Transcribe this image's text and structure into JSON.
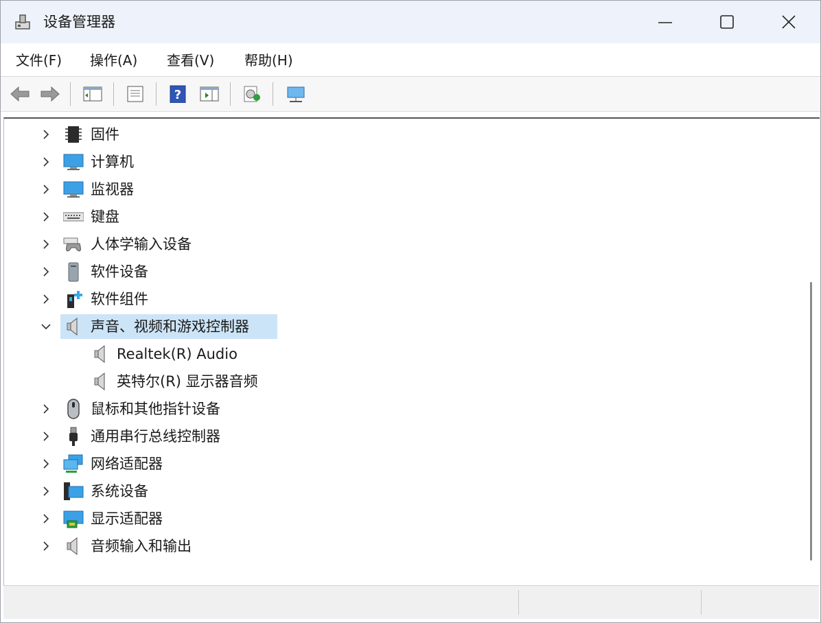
{
  "window": {
    "title": "设备管理器",
    "controls": {
      "minimize": "minimize",
      "maximize": "maximize",
      "close": "close"
    }
  },
  "menu": [
    {
      "label": "文件(F)"
    },
    {
      "label": "操作(A)"
    },
    {
      "label": "查看(V)"
    },
    {
      "label": "帮助(H)"
    }
  ],
  "toolbar": [
    {
      "icon": "back-arrow-icon"
    },
    {
      "icon": "forward-arrow-icon"
    },
    {
      "icon": "show-hide-console-tree-icon"
    },
    {
      "icon": "properties-icon"
    },
    {
      "icon": "help-icon"
    },
    {
      "icon": "action-pane-icon"
    },
    {
      "icon": "scan-hardware-changes-icon"
    },
    {
      "icon": "monitor-device-icon"
    }
  ],
  "tree": {
    "items": [
      {
        "label": "固件",
        "icon": "firmware-chip-icon",
        "expanded": false
      },
      {
        "label": "计算机",
        "icon": "computer-icon",
        "expanded": false
      },
      {
        "label": "监视器",
        "icon": "monitor-icon",
        "expanded": false
      },
      {
        "label": "键盘",
        "icon": "keyboard-icon",
        "expanded": false
      },
      {
        "label": "人体学输入设备",
        "icon": "hid-gamepad-icon",
        "expanded": false
      },
      {
        "label": "软件设备",
        "icon": "software-device-icon",
        "expanded": false
      },
      {
        "label": "软件组件",
        "icon": "software-component-icon",
        "expanded": false
      },
      {
        "label": "声音、视频和游戏控制器",
        "icon": "speaker-icon",
        "expanded": true,
        "selected": true,
        "children": [
          {
            "label": "Realtek(R) Audio",
            "icon": "speaker-icon"
          },
          {
            "label": "英特尔(R) 显示器音频",
            "icon": "speaker-icon"
          }
        ]
      },
      {
        "label": "鼠标和其他指针设备",
        "icon": "mouse-icon",
        "expanded": false
      },
      {
        "label": "通用串行总线控制器",
        "icon": "usb-plug-icon",
        "expanded": false
      },
      {
        "label": "网络适配器",
        "icon": "network-adapter-icon",
        "expanded": false
      },
      {
        "label": "系统设备",
        "icon": "system-device-icon",
        "expanded": false
      },
      {
        "label": "显示适配器",
        "icon": "display-adapter-icon",
        "expanded": false
      },
      {
        "label": "音频输入和输出",
        "icon": "speaker-icon",
        "expanded": false
      }
    ]
  },
  "colors": {
    "titlebar_bg": "#eef3fb",
    "selection_bg": "#cce4f7",
    "accent_blue": "#3b8fd9"
  }
}
